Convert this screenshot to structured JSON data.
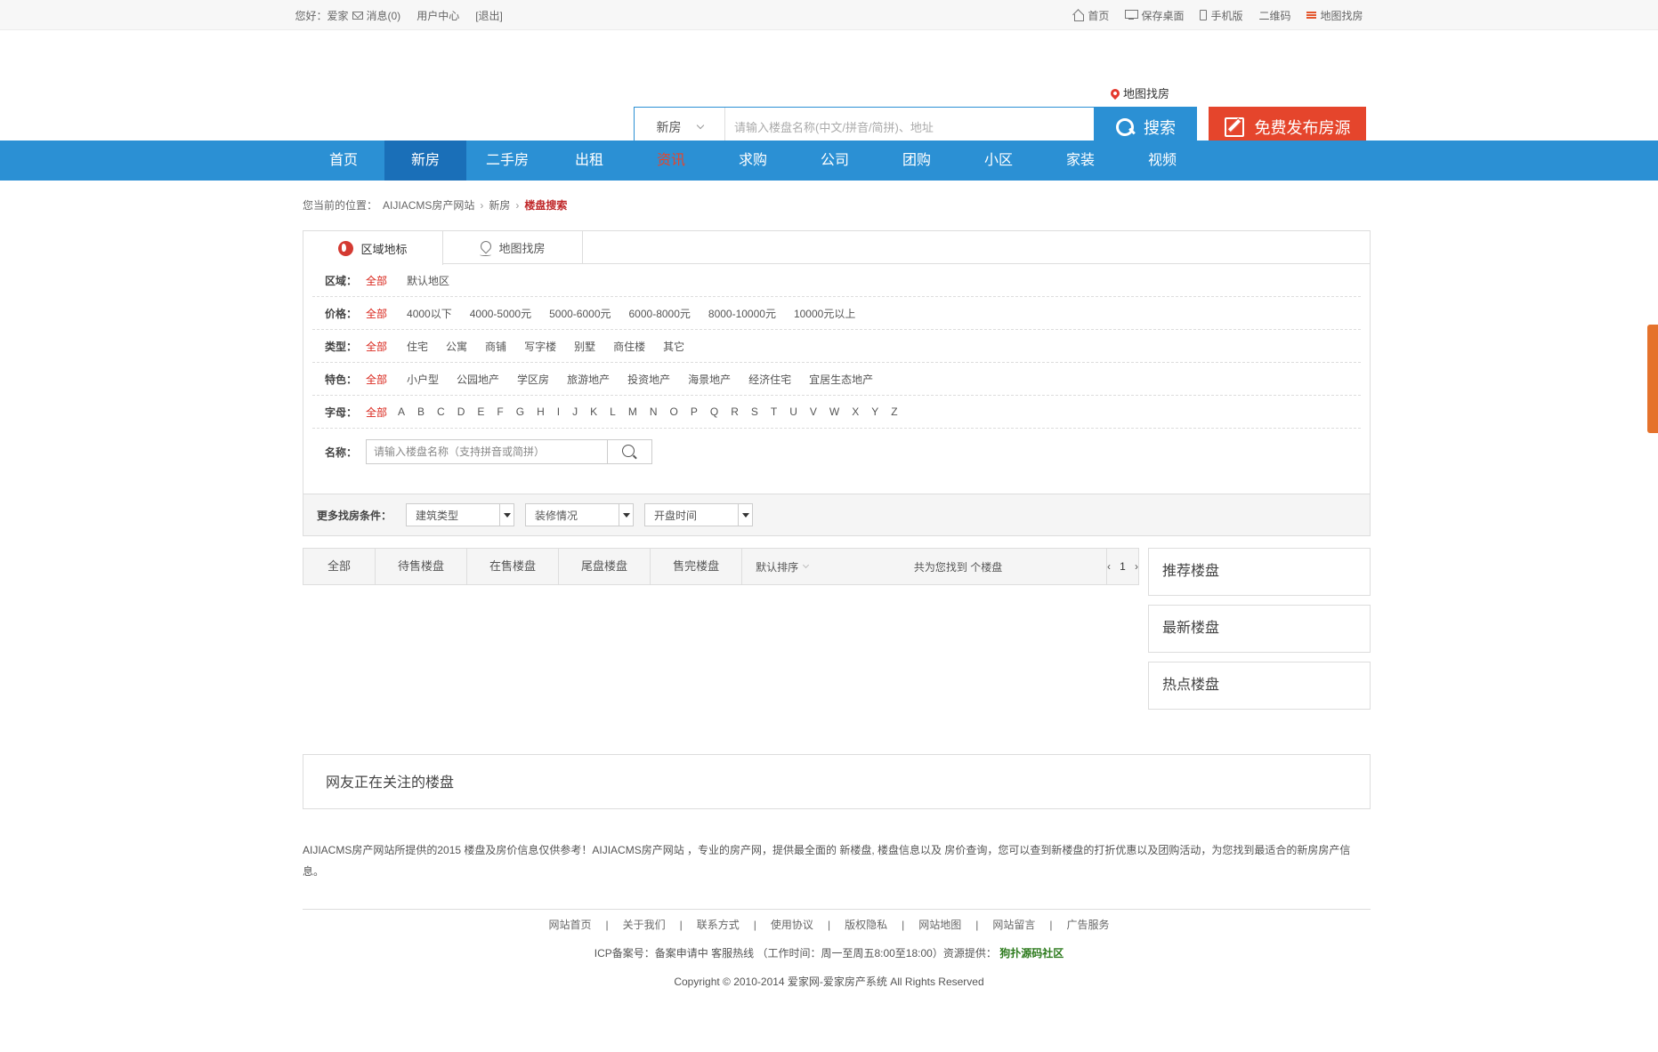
{
  "topbar": {
    "greeting": "您好：爱家",
    "messages": "消息(0)",
    "user_center": "用户中心",
    "logout": "[退出]",
    "home": "首页",
    "save_desktop": "保存桌面",
    "mobile": "手机版",
    "qrcode": "二维码",
    "map_find": "地图找房"
  },
  "header": {
    "map_find": "地图找房",
    "search_type": "新房",
    "search_placeholder": "请输入楼盘名称(中文/拼音/简拼)、地址",
    "search_button": "搜索",
    "publish_button": "免费发布房源"
  },
  "nav": [
    "首页",
    "新房",
    "二手房",
    "出租",
    "资讯",
    "求购",
    "公司",
    "团购",
    "小区",
    "家装",
    "视频"
  ],
  "breadcrumb": {
    "label": "您当前的位置：",
    "site": "AIJIACMS房产网站",
    "section": "新房",
    "current": "楼盘搜索"
  },
  "tabs": {
    "area": "区域地标",
    "map": "地图找房"
  },
  "filters": {
    "area_label": "区域：",
    "area": [
      "全部",
      "默认地区"
    ],
    "price_label": "价格：",
    "price": [
      "全部",
      "4000以下",
      "4000-5000元",
      "5000-6000元",
      "6000-8000元",
      "8000-10000元",
      "10000元以上"
    ],
    "type_label": "类型：",
    "type": [
      "全部",
      "住宅",
      "公寓",
      "商铺",
      "写字楼",
      "别墅",
      "商住楼",
      "其它"
    ],
    "feature_label": "特色：",
    "feature": [
      "全部",
      "小户型",
      "公园地产",
      "学区房",
      "旅游地产",
      "投资地产",
      "海景地产",
      "经济住宅",
      "宜居生态地产"
    ],
    "letter_label": "字母：",
    "letters": [
      "全部",
      "A",
      "B",
      "C",
      "D",
      "E",
      "F",
      "G",
      "H",
      "I",
      "J",
      "K",
      "L",
      "M",
      "N",
      "O",
      "P",
      "Q",
      "R",
      "S",
      "T",
      "U",
      "V",
      "W",
      "X",
      "Y",
      "Z"
    ],
    "name_label": "名称：",
    "name_placeholder": "请输入楼盘名称（支持拼音或简拼）"
  },
  "more": {
    "label": "更多找房条件：",
    "building_type": "建筑类型",
    "decoration": "装修情况",
    "open_time": "开盘时间"
  },
  "results": {
    "tabs": [
      "全部",
      "待售楼盘",
      "在售楼盘",
      "尾盘楼盘",
      "售完楼盘"
    ],
    "sort": "默认排序",
    "found": "共为您找到 个楼盘",
    "prev": "‹",
    "page": "1",
    "next": "›"
  },
  "sidebar": {
    "recommended": "推荐楼盘",
    "newest": "最新楼盘",
    "hot": "热点楼盘"
  },
  "watching": "网友正在关注的楼盘",
  "description": "AIJIACMS房产网站所提供的2015 楼盘及房价信息仅供参考！AIJIACMS房产网站 ，专业的房产网，提供最全面的 新楼盘, 楼盘信息以及 房价查询，您可以查到新楼盘的打折优惠以及团购活动，为您找到最适合的新房房产信息。",
  "footer": {
    "links": [
      "网站首页",
      "关于我们",
      "联系方式",
      "使用协议",
      "版权隐私",
      "网站地图",
      "网站留言",
      "广告服务"
    ],
    "separator": "|",
    "icp": "ICP备案号：备案申请中 客服热线 （工作时间：周一至周五8:00至18:00）资源提供：",
    "source": "狗扑源码社区",
    "copyright": "Copyright © 2010-2014 爱家网-爱家房产系统 All Rights Reserved"
  },
  "colors": {
    "primary": "#2b90d4",
    "nav_active": "#1a6fb8",
    "accent_red": "#e5452c",
    "filter_active": "#d9261c"
  }
}
